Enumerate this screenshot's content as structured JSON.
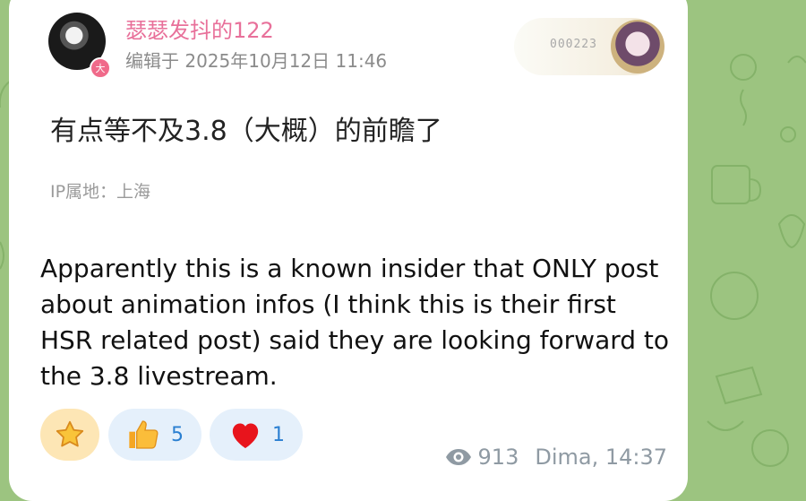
{
  "post": {
    "username": "瑟瑟发抖的122",
    "edit_time": "编辑于 2025年10月12日 11:46",
    "avatar_badge": "大",
    "badge_number": "000223",
    "title": "有点等不及3.8（大概）的前瞻了",
    "ip_location": "IP属地：上海"
  },
  "message": {
    "caption": "Apparently this is a known insider that ONLY post about animation infos (I think this is their first HSR related post) said they are looking forward to the 3.8 livestream.",
    "views": "913",
    "author_time": "Dima, 14:37"
  },
  "reactions": [
    {
      "icon": "star-icon",
      "count": ""
    },
    {
      "icon": "thumbs-up-icon",
      "count": "5"
    },
    {
      "icon": "heart-icon",
      "count": "1"
    }
  ],
  "colors": {
    "wallpaper": "#9cc480",
    "username": "#e8709a",
    "reaction_count": "#2a7fd1"
  }
}
